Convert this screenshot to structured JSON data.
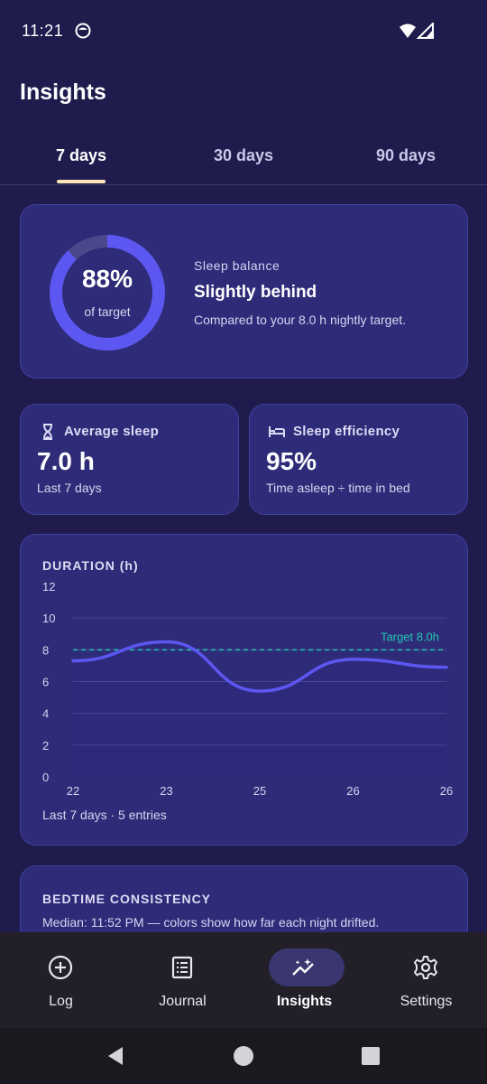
{
  "status": {
    "time": "11:21"
  },
  "page": {
    "title": "Insights"
  },
  "tabs": [
    {
      "label": "7 days",
      "active": true
    },
    {
      "label": "30 days",
      "active": false
    },
    {
      "label": "90 days",
      "active": false
    }
  ],
  "balance": {
    "percent": "88%",
    "percent_value": 88,
    "ring_sub": "of target",
    "label": "Sleep balance",
    "title": "Slightly behind",
    "description": "Compared to your 8.0 h nightly target."
  },
  "stats": {
    "average": {
      "icon": "hourglass-icon",
      "label": "Average sleep",
      "value": "7.0 h",
      "sub": "Last 7 days"
    },
    "efficiency": {
      "icon": "bed-icon",
      "label": "Sleep efficiency",
      "value": "95%",
      "sub": "Time asleep ÷ time in bed"
    }
  },
  "chart_data": {
    "type": "area",
    "title": "DURATION (h)",
    "x": [
      "22",
      "23",
      "25",
      "26",
      "26"
    ],
    "series": [
      {
        "values": [
          7.3,
          8.5,
          5.4,
          7.4,
          6.9
        ]
      }
    ],
    "ylim": [
      0,
      12
    ],
    "yticks": [
      "0",
      "2",
      "4",
      "6",
      "8",
      "10",
      "12"
    ],
    "target": {
      "value": 8.0,
      "label": "Target 8.0h"
    },
    "grid": true,
    "footer": "Last 7 days · 5 entries",
    "colors": {
      "line": "#5b57f0",
      "area": "#2d2a7c",
      "target": "#26c6b0"
    }
  },
  "bedtime": {
    "title": "BEDTIME CONSISTENCY",
    "description": "Median: 11:52 PM — colors show how far each night drifted."
  },
  "nav": [
    {
      "label": "Log",
      "icon": "add-circle-icon",
      "active": false
    },
    {
      "label": "Journal",
      "icon": "journal-icon",
      "active": false
    },
    {
      "label": "Insights",
      "icon": "insights-icon",
      "active": true
    },
    {
      "label": "Settings",
      "icon": "gear-icon",
      "active": false
    }
  ],
  "colors": {
    "background": "#1f1c4d",
    "card": "#2e2b78",
    "accent": "#5b57f0",
    "tab_indicator": "#fde7b9"
  }
}
